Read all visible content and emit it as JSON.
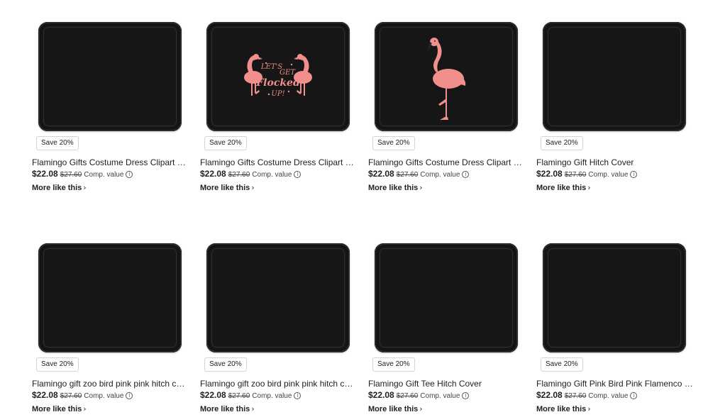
{
  "products": [
    {
      "badge": "Save 20%",
      "title": "Flamingo Gifts Costume Dress Clipart Ka...",
      "price": "$22.08",
      "old_price": "$27.60",
      "comp": "Comp. value",
      "more": "More like this",
      "art": "none"
    },
    {
      "badge": "Save 20%",
      "title": "Flamingo Gifts Costume Dress Clipart Flo...",
      "price": "$22.08",
      "old_price": "$27.60",
      "comp": "Comp. value",
      "more": "More like this",
      "art": "two-flamingos",
      "art_text": [
        "LET'S",
        "GET",
        "Flocked",
        "UP!"
      ]
    },
    {
      "badge": "Save 20%",
      "title": "Flamingo Gifts Costume Dress Clipart Dr...",
      "price": "$22.08",
      "old_price": "$27.60",
      "comp": "Comp. value",
      "more": "More like this",
      "art": "flamingo"
    },
    {
      "badge": "Save 20%",
      "title": "Flamingo Gift Hitch Cover",
      "price": "$22.08",
      "old_price": "$27.60",
      "comp": "Comp. value",
      "more": "More like this",
      "art": "none"
    },
    {
      "badge": "Save 20%",
      "title": "Flamingo gift zoo bird pink pink hitch cov...",
      "price": "$22.08",
      "old_price": "$27.60",
      "comp": "Comp. value",
      "more": "More like this",
      "art": "none"
    },
    {
      "badge": "Save 20%",
      "title": "Flamingo gift zoo bird pink pink hitch cov...",
      "price": "$22.08",
      "old_price": "$27.60",
      "comp": "Comp. value",
      "more": "More like this",
      "art": "none"
    },
    {
      "badge": "Save 20%",
      "title": "Flamingo Gift Tee Hitch Cover",
      "price": "$22.08",
      "old_price": "$27.60",
      "comp": "Comp. value",
      "more": "More like this",
      "art": "none"
    },
    {
      "badge": "Save 20%",
      "title": "Flamingo Gift Pink Bird Pink Flamenco Pa...",
      "price": "$22.08",
      "old_price": "$27.60",
      "comp": "Comp. value",
      "more": "More like this",
      "art": "none"
    }
  ],
  "icons": {
    "info": "info-icon",
    "chevron": "chevron-right-icon"
  },
  "colors": {
    "flamingo_pink": "#f08f8c",
    "cover_black": "#1a1a1a"
  }
}
